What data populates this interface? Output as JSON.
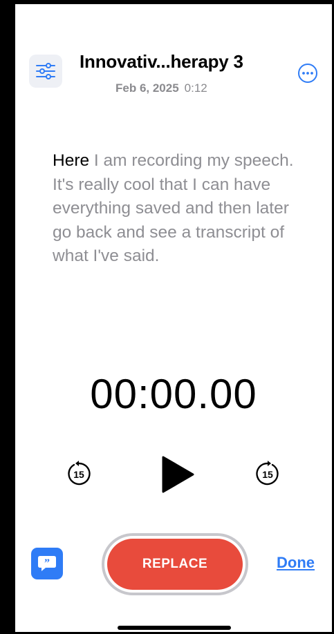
{
  "header": {
    "title": "Innovativ...herapy 3",
    "date": "Feb 6, 2025",
    "duration": "0:12"
  },
  "transcript": {
    "highlighted": "Here",
    "rest": " I am recording my speech. It's really cool that I can have everything saved and then later go back and see a transcript of what I've said."
  },
  "player": {
    "timer": "00:00.00",
    "skip_back_label": "15",
    "skip_forward_label": "15"
  },
  "footer": {
    "replace_label": "REPLACE",
    "done_label": "Done"
  },
  "colors": {
    "accent": "#2f7cf6",
    "record": "#e84b3c",
    "secondary_text": "#8e8e93"
  },
  "icons": {
    "settings": "sliders-icon",
    "more": "ellipsis-circle-icon",
    "skip_back": "skip-back-15-icon",
    "play": "play-icon",
    "skip_forward": "skip-forward-15-icon",
    "transcript": "quote-bubble-icon"
  }
}
